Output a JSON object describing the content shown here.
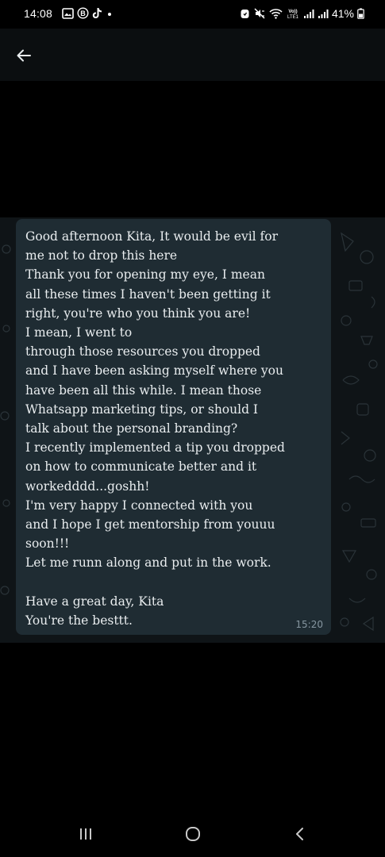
{
  "status_bar": {
    "time": "14:08",
    "battery_percent": "41%",
    "left_icons": [
      "gallery-icon",
      "b-icon",
      "tiktok-icon",
      "dot-icon"
    ],
    "right_icons": [
      "alarm-icon",
      "mute-icon",
      "wifi-icon",
      "volte-icon",
      "signal-icon",
      "signal-icon-2",
      "battery-icon"
    ],
    "volte_label": "Vo)) LTE1"
  },
  "header": {
    "back_icon": "arrow-left-icon"
  },
  "message": {
    "text": "Good afternoon Kita, It would be evil for\nme not to drop this here\nThank you for opening my eye, I mean\nall these times I haven't been getting it\nright, you're who you think you are!\nI mean, I went to\nthrough those resources you dropped\nand I have been asking myself where you\nhave been all this while. I mean those\nWhatsapp marketing tips, or should I\ntalk about the personal branding?\nI recently implemented a tip you dropped\non how to communicate better and it\nworkedddd...goshh!\nI'm very happy I connected with you\nand I hope I get mentorship from youuu\nsoon!!!\nLet me runn along and put in the work.\n\nHave a great day, Kita\nYou're the besttt.",
    "time": "15:20"
  },
  "nav_bar": {
    "icons": [
      "recents-icon",
      "home-icon",
      "back-icon"
    ]
  },
  "colors": {
    "background": "#000000",
    "header": "#0b0e10",
    "chat_background": "#0f1417",
    "bubble": "#1f2c33",
    "text": "#e9edef",
    "timestamp": "#8696a0"
  }
}
